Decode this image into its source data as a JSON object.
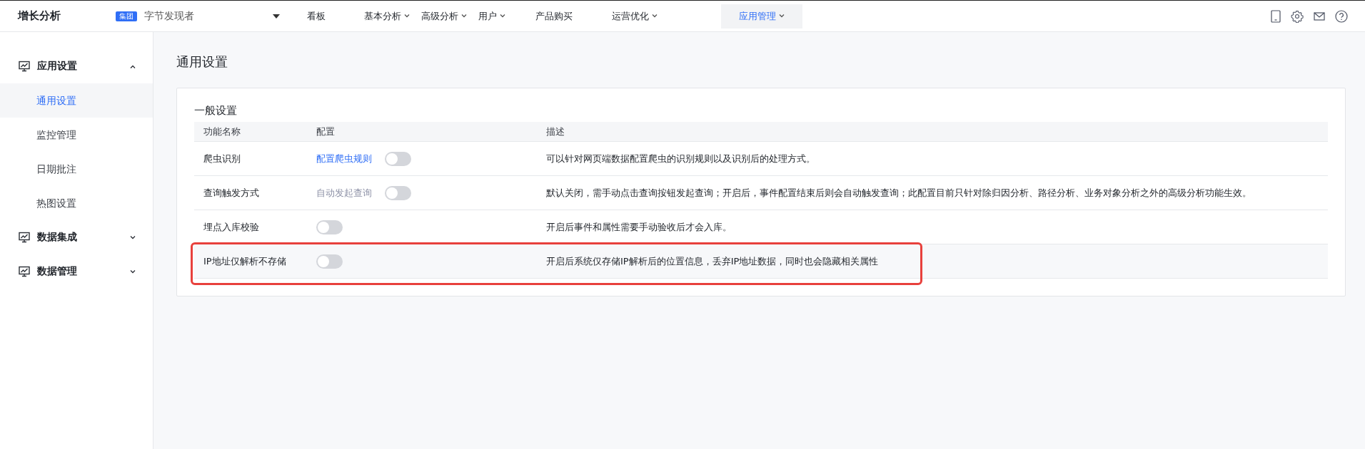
{
  "topbar": {
    "logo": "增长分析",
    "org_badge": "集团",
    "project": "字节发现者",
    "nav": [
      {
        "label": "看板",
        "dropdown": false,
        "selected": false
      },
      {
        "label": "基本分析",
        "dropdown": true,
        "selected": false
      },
      {
        "label": "高级分析",
        "dropdown": true,
        "selected": false
      },
      {
        "label": "用户",
        "dropdown": true,
        "selected": false
      },
      {
        "label": "产品购买",
        "dropdown": false,
        "selected": false
      },
      {
        "label": "运营优化",
        "dropdown": true,
        "selected": false
      },
      {
        "label": "应用管理",
        "dropdown": true,
        "selected": true
      }
    ]
  },
  "sidebar": {
    "groups": [
      {
        "label": "应用设置",
        "expanded": true,
        "children": [
          {
            "label": "通用设置",
            "selected": true
          },
          {
            "label": "监控管理",
            "selected": false
          },
          {
            "label": "日期批注",
            "selected": false
          },
          {
            "label": "热图设置",
            "selected": false
          }
        ]
      },
      {
        "label": "数据集成",
        "expanded": false
      },
      {
        "label": "数据管理",
        "expanded": false
      }
    ]
  },
  "page_title": "通用设置",
  "section": {
    "title": "一般设置",
    "columns": [
      "功能名称",
      "配置",
      "描述"
    ],
    "rows": [
      {
        "name": "爬虫识别",
        "config": {
          "kind": "link",
          "text": "配置爬虫规则"
        },
        "on": false,
        "description": "可以针对网页端数据配置爬虫的识别规则以及识别后的处理方式。",
        "highlighted": false
      },
      {
        "name": "查询触发方式",
        "config": {
          "kind": "muted",
          "text": "自动发起查询"
        },
        "on": false,
        "description": "默认关闭，需手动点击查询按钮发起查询；开启后，事件配置结束后则会自动触发查询；此配置目前只针对除归因分析、路径分析、业务对象分析之外的高级分析功能生效。",
        "highlighted": false
      },
      {
        "name": "埋点入库校验",
        "on": false,
        "description": "开启后事件和属性需要手动验收后才会入库。",
        "highlighted": false
      },
      {
        "name": "IP地址仅解析不存储",
        "on": false,
        "description": "开启后系统仅存储IP解析后的位置信息，丢弃IP地址数据，同时也会隐藏相关属性",
        "highlighted": true
      }
    ]
  }
}
